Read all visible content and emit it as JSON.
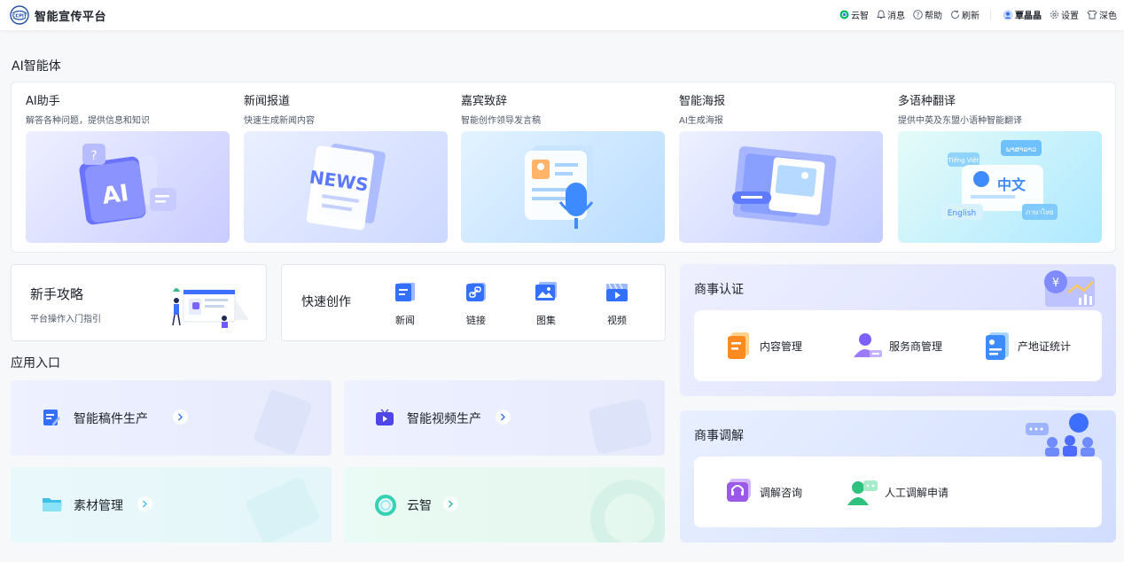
{
  "header": {
    "logo_text": "CCPIT",
    "brand": "智能宣传平台",
    "tools": [
      {
        "icon": "yunzhi-icon",
        "label": "云智"
      },
      {
        "icon": "bell-icon",
        "label": "消息"
      },
      {
        "icon": "help-icon",
        "label": "帮助"
      },
      {
        "icon": "refresh-icon",
        "label": "刷新"
      }
    ],
    "user": {
      "icon": "user-avatar-icon",
      "name": "覃晶晶"
    },
    "settings_label": "设置",
    "theme_label": "深色"
  },
  "ai_section": {
    "title": "AI智能体",
    "cards": [
      {
        "title": "AI助手",
        "subtitle": "解答各种问题，提供信息和知识",
        "illustration": "ai-assistant-illustration",
        "badge": "AI"
      },
      {
        "title": "新闻报道",
        "subtitle": "快速生成新闻内容",
        "illustration": "news-illustration",
        "badge": "NEWS"
      },
      {
        "title": "嘉宾致辞",
        "subtitle": "智能创作领导发言稿",
        "illustration": "microphone-illustration"
      },
      {
        "title": "智能海报",
        "subtitle": "AI生成海报",
        "illustration": "poster-illustration"
      },
      {
        "title": "多语种翻译",
        "subtitle": "提供中英及东盟小语种智能翻译",
        "illustration": "translation-illustration",
        "badge": "中文",
        "tags": [
          "Tiếng Việt",
          "ພາສາລາວ",
          "English",
          "ภาษาไทย"
        ]
      }
    ]
  },
  "guide": {
    "title": "新手攻略",
    "subtitle": "平台操作入门指引"
  },
  "quick_create": {
    "title": "快速创作",
    "items": [
      {
        "label": "新闻",
        "icon": "news-doc-icon"
      },
      {
        "label": "链接",
        "icon": "link-icon"
      },
      {
        "label": "图集",
        "icon": "gallery-icon"
      },
      {
        "label": "视频",
        "icon": "video-icon"
      }
    ]
  },
  "apps": {
    "title": "应用入口",
    "items": [
      {
        "label": "智能稿件生产",
        "icon": "edit-doc-icon"
      },
      {
        "label": "智能视频生产",
        "icon": "tv-play-icon"
      },
      {
        "label": "素材管理",
        "icon": "folder-icon"
      },
      {
        "label": "云智",
        "icon": "yunzhi-ring-icon"
      }
    ]
  },
  "cert": {
    "title": "商事认证",
    "items": [
      {
        "label": "内容管理",
        "icon": "content-doc-icon"
      },
      {
        "label": "服务商管理",
        "icon": "provider-user-icon"
      },
      {
        "label": "产地证统计",
        "icon": "certificate-stat-icon"
      }
    ]
  },
  "mediation": {
    "title": "商事调解",
    "items": [
      {
        "label": "调解咨询",
        "icon": "headset-chat-icon"
      },
      {
        "label": "人工调解申请",
        "icon": "person-chat-icon"
      }
    ]
  },
  "colors": {
    "primary": "#3370ff",
    "accent_green": "#00b96b",
    "orange": "#ff8a1f",
    "purple": "#7b61ff"
  }
}
